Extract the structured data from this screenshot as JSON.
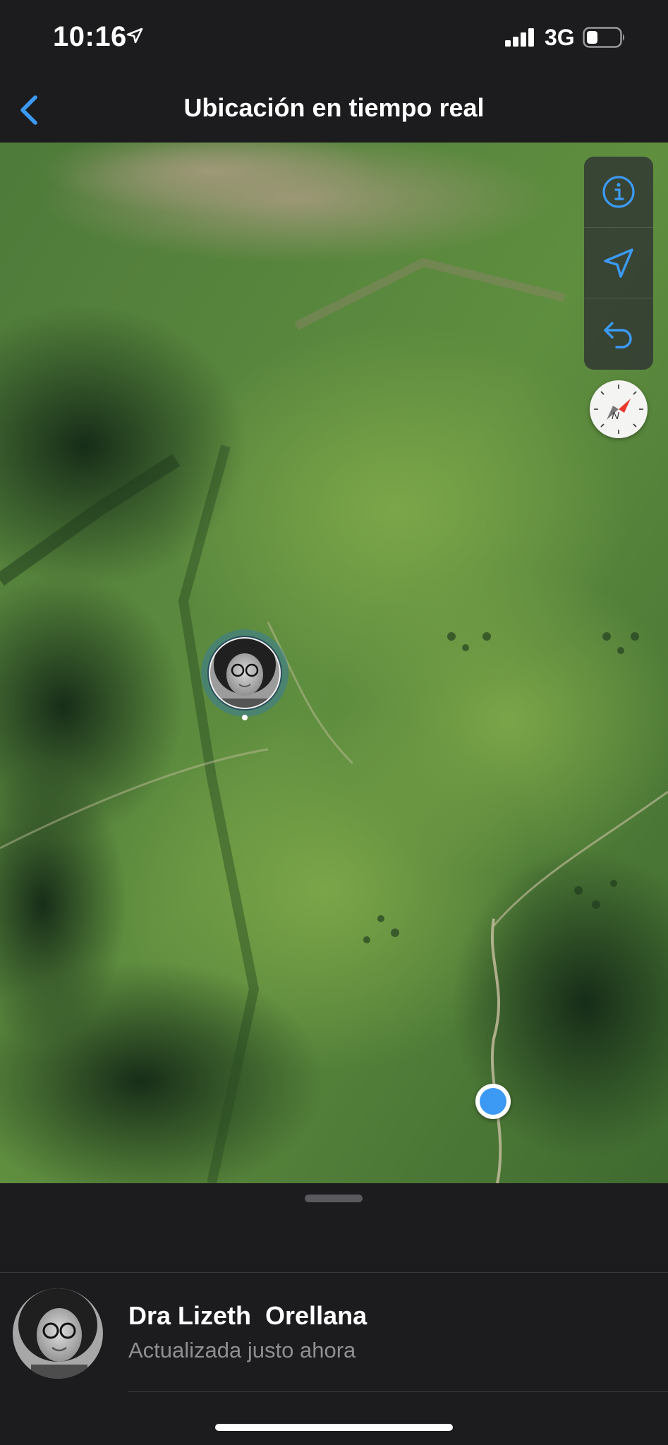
{
  "status_bar": {
    "time": "10:16",
    "network": "3G",
    "icons": [
      "location-arrow-icon",
      "signal-icon",
      "battery-icon"
    ]
  },
  "nav": {
    "title": "Ubicación en tiempo real",
    "back_icon": "chevron-left-icon"
  },
  "map": {
    "view": "satellite",
    "controls": [
      "info-icon",
      "location-arrow-icon",
      "undo-arrow-icon"
    ],
    "compass_icon": "compass-icon",
    "compass_letter": "N"
  },
  "contact": {
    "name": "Dra Lizeth  Orellana",
    "status": "Actualizada justo ahora"
  },
  "colors": {
    "accent": "#3c9af5",
    "background": "#1c1c1e",
    "secondary_text": "#8e8e93"
  }
}
